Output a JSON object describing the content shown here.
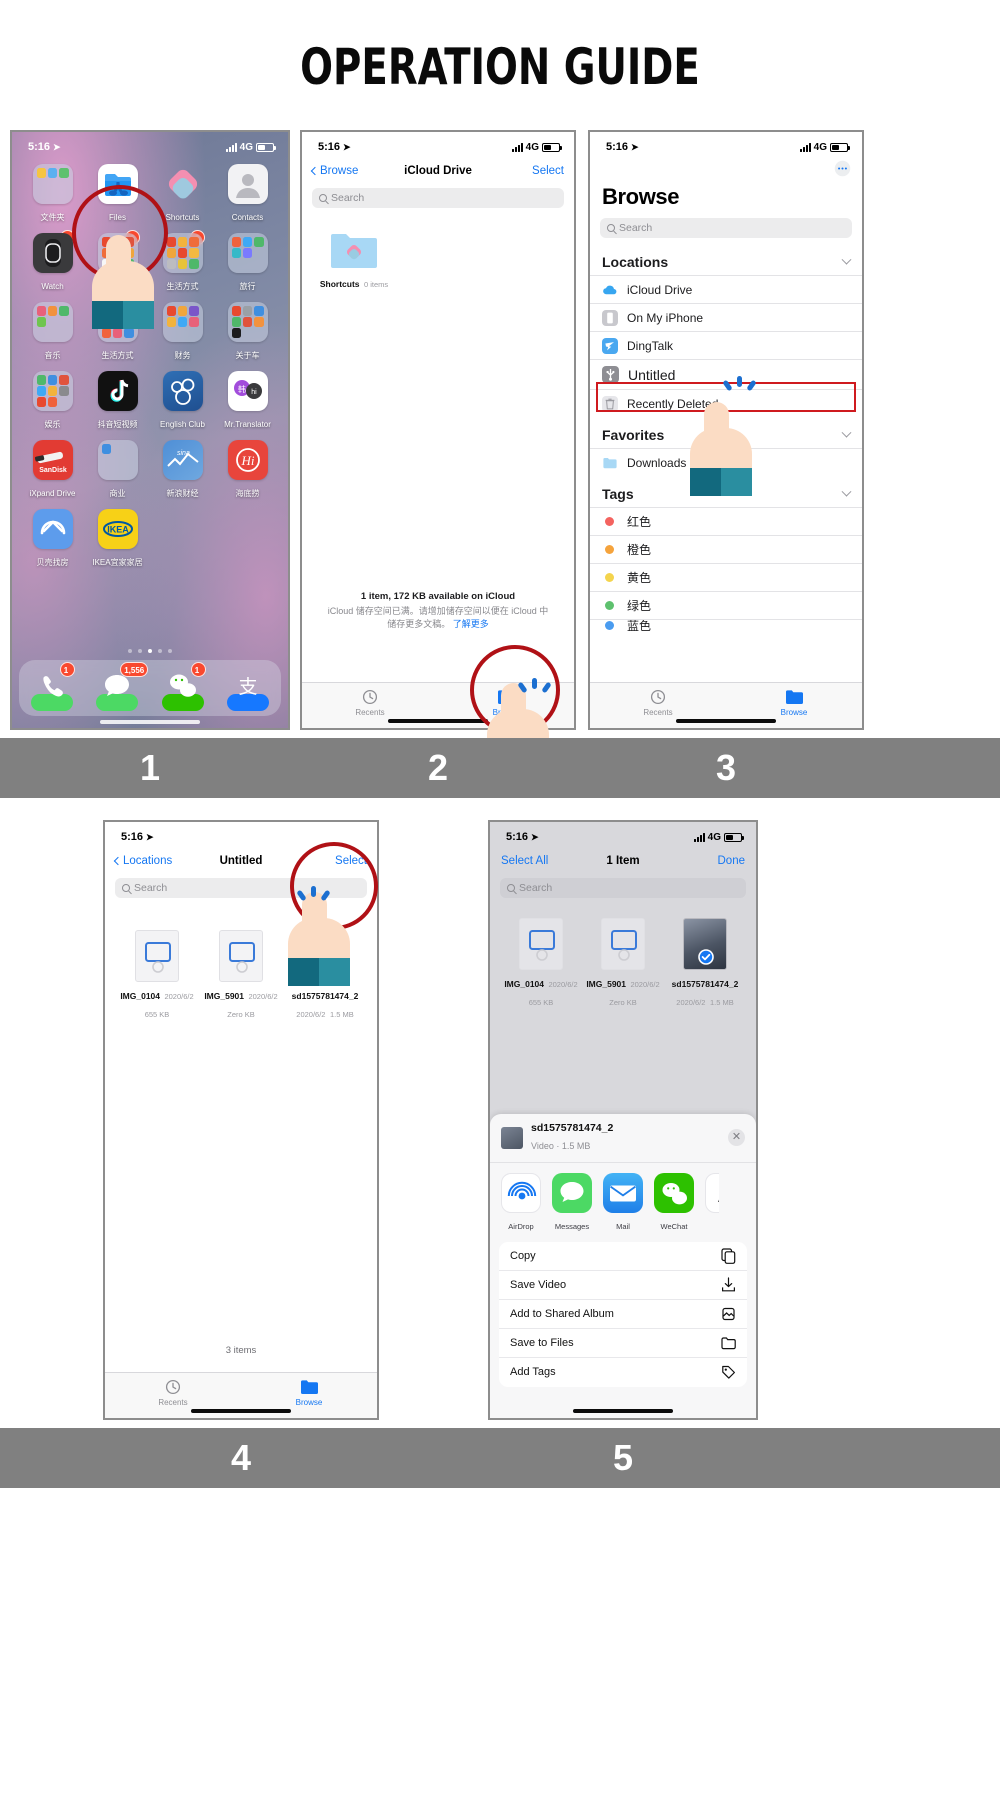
{
  "title": "OPERATION GUIDE",
  "captions": [
    "1",
    "2",
    "3",
    "4",
    "5"
  ],
  "status": {
    "time": "5:16",
    "network": "4G",
    "location_arrow": "location-arrow-icon"
  },
  "panel1": {
    "name": "iphone-home-screen",
    "apps": [
      {
        "label": "文件夹",
        "type": "folder",
        "badge": ""
      },
      {
        "label": "Files",
        "type": "files",
        "badge": ""
      },
      {
        "label": "Shortcuts",
        "type": "shortcuts",
        "badge": ""
      },
      {
        "label": "Contacts",
        "type": "contacts",
        "badge": ""
      },
      {
        "label": "Watch",
        "type": "watch",
        "badge": "1"
      },
      {
        "label": "生活方式",
        "type": "folder",
        "badge": "1"
      },
      {
        "label": "生活方式",
        "type": "folder",
        "badge": "1"
      },
      {
        "label": "旅行",
        "type": "folder",
        "badge": ""
      },
      {
        "label": "音乐",
        "type": "folder",
        "badge": ""
      },
      {
        "label": "生活方式",
        "type": "folder",
        "badge": ""
      },
      {
        "label": "财务",
        "type": "folder",
        "badge": ""
      },
      {
        "label": "关于车",
        "type": "folder",
        "badge": ""
      },
      {
        "label": "娱乐",
        "type": "folder",
        "badge": ""
      },
      {
        "label": "抖音短视频",
        "type": "tiktok",
        "badge": ""
      },
      {
        "label": "English Club",
        "type": "disney",
        "badge": ""
      },
      {
        "label": "Mr.Translator",
        "type": "translator",
        "badge": ""
      },
      {
        "label": "iXpand Drive",
        "type": "sandisk",
        "badge": ""
      },
      {
        "label": "商业",
        "type": "folder-empty",
        "badge": ""
      },
      {
        "label": "新浪财经",
        "type": "sina",
        "badge": ""
      },
      {
        "label": "海底捞",
        "type": "haidilao",
        "badge": ""
      },
      {
        "label": "贝壳找房",
        "type": "beike",
        "badge": ""
      },
      {
        "label": "IKEA宜家家居",
        "type": "ikea",
        "badge": ""
      }
    ],
    "page_dots": 5,
    "active_dot": 3,
    "dock": [
      {
        "name": "phone",
        "badge": "1"
      },
      {
        "name": "messages",
        "badge": "1,556"
      },
      {
        "name": "wechat",
        "badge": "1"
      },
      {
        "name": "alipay",
        "badge": ""
      }
    ]
  },
  "panel2": {
    "name": "icloud-drive-screen",
    "back": "Browse",
    "title": "iCloud Drive",
    "action": "Select",
    "search_placeholder": "Search",
    "items": [
      {
        "name": "Shortcuts",
        "meta": "0 items"
      }
    ],
    "footer_line1": "1 item, 172 KB available on iCloud",
    "footer_line2": "iCloud 储存空间已满。请增加储存空间以便在 iCloud 中",
    "footer_line3": "储存更多文稿。",
    "footer_link": "了解更多",
    "tabs": [
      {
        "label": "Recents",
        "icon": "clock-icon",
        "active": false
      },
      {
        "label": "Browse",
        "icon": "folder-icon",
        "active": true
      }
    ]
  },
  "panel3": {
    "name": "browse-locations-screen",
    "title": "Browse",
    "search_placeholder": "Search",
    "more_icon": "ellipsis-circle-icon",
    "sections": [
      {
        "header": "Locations",
        "rows": [
          {
            "label": "iCloud Drive",
            "icon": "icloud-icon",
            "highlight": false
          },
          {
            "label": "On My iPhone",
            "icon": "iphone-icon",
            "highlight": false
          },
          {
            "label": "DingTalk",
            "icon": "dingtalk-icon",
            "highlight": false
          },
          {
            "label": "Untitled",
            "icon": "usb-icon",
            "highlight": true
          },
          {
            "label": "Recently Deleted",
            "icon": "trash-icon",
            "highlight": false
          }
        ]
      },
      {
        "header": "Favorites",
        "rows": [
          {
            "label": "Downloads",
            "icon": "folder-icon",
            "highlight": false
          }
        ]
      },
      {
        "header": "Tags",
        "rows": [
          {
            "label": "红色",
            "color": "#f4635f",
            "highlight": false
          },
          {
            "label": "橙色",
            "color": "#f5a33c",
            "highlight": false
          },
          {
            "label": "黄色",
            "color": "#f4d44d",
            "highlight": false
          },
          {
            "label": "绿色",
            "color": "#5ec16e",
            "highlight": false
          },
          {
            "label": "蓝色",
            "color": "#4a9cf0",
            "highlight": false
          }
        ]
      }
    ],
    "tabs": [
      {
        "label": "Recents",
        "icon": "clock-icon",
        "active": false
      },
      {
        "label": "Browse",
        "icon": "folder-icon",
        "active": true
      }
    ]
  },
  "panel4": {
    "name": "untitled-folder-screen",
    "back": "Locations",
    "title": "Untitled",
    "action": "Select",
    "search_placeholder": "Search",
    "files": [
      {
        "name": "IMG_0104",
        "date": "2020/6/2",
        "size": "655 KB"
      },
      {
        "name": "IMG_5901",
        "date": "2020/6/2",
        "size": "Zero KB"
      },
      {
        "name": "sd1575781474_2",
        "date": "2020/6/2",
        "size": "1.5 MB"
      }
    ],
    "footer": "3 items",
    "tabs": [
      {
        "label": "Recents",
        "icon": "clock-icon",
        "active": false
      },
      {
        "label": "Browse",
        "icon": "folder-icon",
        "active": true
      }
    ]
  },
  "panel5": {
    "name": "share-sheet-screen",
    "select_all": "Select All",
    "count_title": "1 Item",
    "done": "Done",
    "search_placeholder": "Search",
    "files": [
      {
        "name": "IMG_0104",
        "date": "2020/6/2",
        "size": "655 KB",
        "selected": false
      },
      {
        "name": "IMG_5901",
        "date": "2020/6/2",
        "size": "Zero KB",
        "selected": false
      },
      {
        "name": "sd1575781474_2",
        "date": "2020/6/2",
        "size": "1.5 MB",
        "selected": true
      }
    ],
    "sheet": {
      "file_name": "sd1575781474_2",
      "file_meta": "Video · 1.5 MB",
      "close_icon": "close-icon",
      "apps": [
        {
          "label": "AirDrop",
          "icon": "airdrop-icon"
        },
        {
          "label": "Messages",
          "icon": "messages-icon"
        },
        {
          "label": "Mail",
          "icon": "mail-icon"
        },
        {
          "label": "WeChat",
          "icon": "wechat-icon"
        }
      ],
      "actions": [
        {
          "label": "Copy",
          "icon": "copy-icon"
        },
        {
          "label": "Save Video",
          "icon": "download-icon"
        },
        {
          "label": "Add to Shared Album",
          "icon": "album-icon"
        },
        {
          "label": "Save to Files",
          "icon": "folder-icon"
        },
        {
          "label": "Add Tags",
          "icon": "tag-icon"
        }
      ]
    }
  }
}
